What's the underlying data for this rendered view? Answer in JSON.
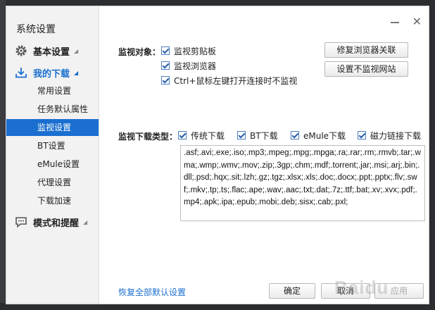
{
  "window": {
    "close_glyph": "✕"
  },
  "sidebar": {
    "title": "系统设置",
    "groups": [
      {
        "label": "基本设置",
        "icon": "gear-icon"
      },
      {
        "label": "我的下载",
        "icon": "download-icon"
      },
      {
        "label": "模式和提醒",
        "icon": "chat-bubble-icon"
      }
    ],
    "items": [
      "常用设置",
      "任务默认属性",
      "监视设置",
      "BT设置",
      "eMule设置",
      "代理设置",
      "下载加速"
    ],
    "selected_item": "监视设置"
  },
  "monitor": {
    "label": "监视对象：",
    "options": [
      "监视剪贴板",
      "监视浏览器",
      "Ctrl+鼠标左键打开连接时不监视"
    ],
    "repair_button": "修复浏览器关联",
    "exclude_button": "设置不监视网站"
  },
  "download_types": {
    "label": "监视下载类型：",
    "options": [
      "传统下载",
      "BT下载",
      "eMule下载",
      "磁力链接下载"
    ],
    "extensions": ".asf;.avi;.exe;.iso;.mp3;.mpeg;.mpg;.mpga;.ra;.rar;.rm;.rmvb;.tar;.wma;.wmp;.wmv;.mov;.zip;.3gp;.chm;.mdf;.torrent;.jar;.msi;.arj;.bin;.dll;.psd;.hqx;.sit;.lzh;.gz;.tgz;.xlsx;.xls;.doc;.docx;.ppt;.pptx;.flv;.swf;.mkv;.tp;.ts;.flac;.ape;.wav;.aac;.txt;.dat;.7z;.ttf;.bat;.xv;.xvx;.pdf;.mp4;.apk;.ipa;.epub;.mobi;.deb;.sisx;.cab;.pxl;"
  },
  "footer": {
    "restore_link": "恢复全部默认设置",
    "ok": "确定",
    "cancel": "取消",
    "apply": "应用"
  },
  "watermark": "Baidu",
  "colors": {
    "accent": "#1a6fd0"
  }
}
